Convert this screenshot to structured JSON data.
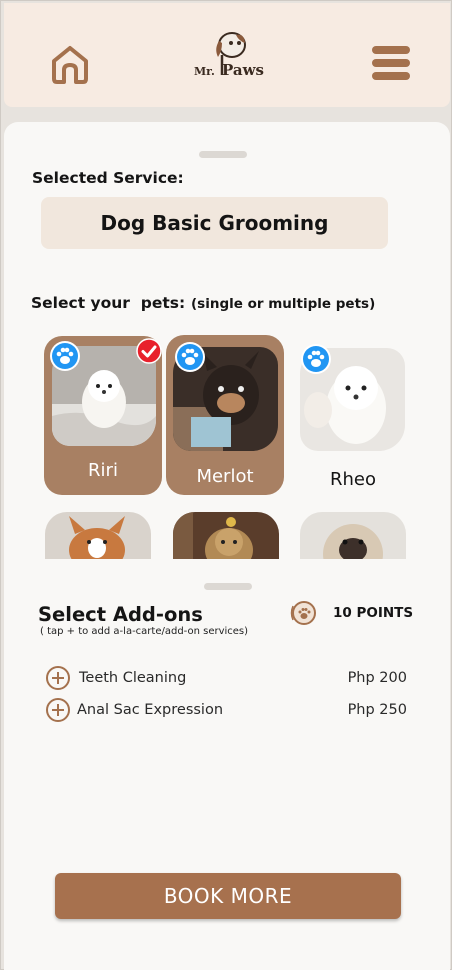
{
  "header": {
    "logo_text": "Mr.Paws",
    "home_icon": "home-icon",
    "menu_icon": "hamburger-menu-icon"
  },
  "service": {
    "label": "Selected Service:",
    "value": "Dog Basic Grooming"
  },
  "pets": {
    "label": "Select your  pets:",
    "hint": "(single or multiple pets)",
    "items": [
      {
        "name": "Riri",
        "selected": true,
        "checked": true
      },
      {
        "name": "Merlot",
        "selected": true,
        "checked": false
      },
      {
        "name": "Rheo",
        "selected": false,
        "checked": false
      }
    ]
  },
  "addons": {
    "title": "Select Add-ons",
    "subtitle": "( tap + to add a-la-carte/add-on services)",
    "points": "10 POINTS",
    "items": [
      {
        "name": "Teeth Cleaning",
        "price": "Php 200"
      },
      {
        "name": "Anal Sac Expression",
        "price": "Php 250"
      }
    ]
  },
  "book_button": "BOOK MORE",
  "colors": {
    "brand_brown": "#a7714e",
    "selected_card": "#a88063",
    "paw_badge_blue": "#2196f3",
    "check_red": "#e8212c",
    "header_bg": "#f7ebe2"
  }
}
